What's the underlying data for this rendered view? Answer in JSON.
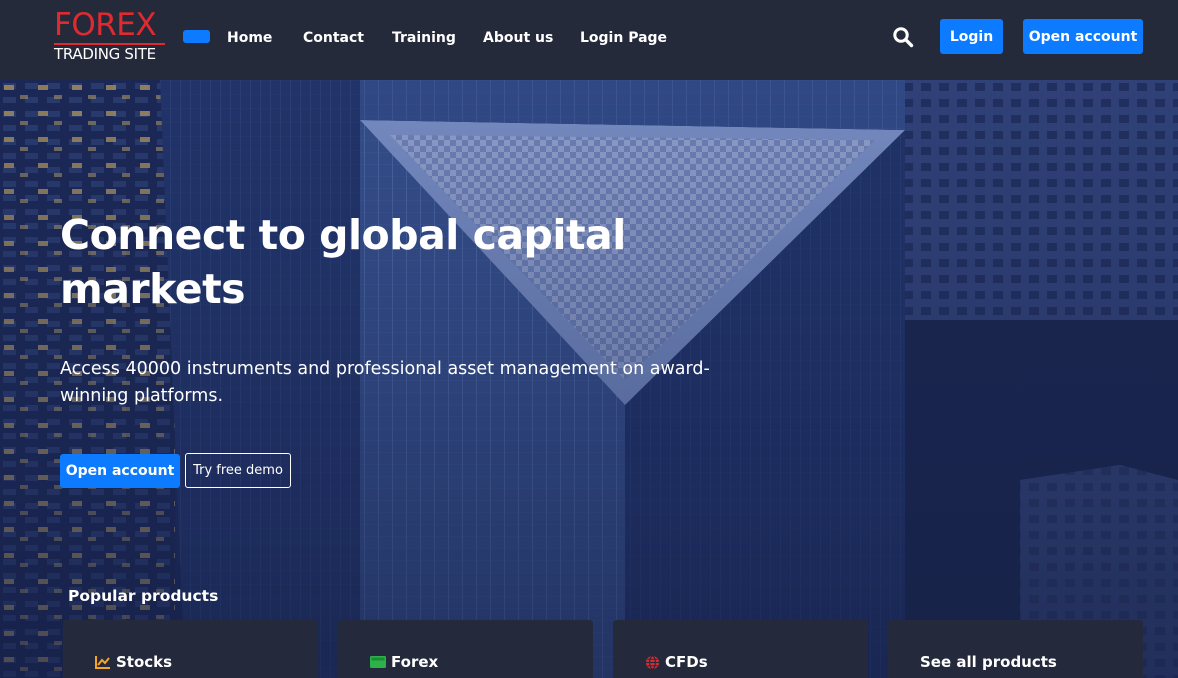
{
  "brand": {
    "logo_top": "FOREX",
    "logo_bottom": "TRADING SITE",
    "accent_color": "#e02a30"
  },
  "nav": {
    "items": [
      {
        "label": "Home"
      },
      {
        "label": "Contact"
      },
      {
        "label": "Training"
      },
      {
        "label": "About us"
      },
      {
        "label": "Login Page"
      }
    ],
    "toggler_icon": "menu-toggle-icon",
    "search_icon": "search-icon",
    "login_label": "Login",
    "open_account_label": "Open account",
    "button_color": "#0d7bff"
  },
  "hero": {
    "title": "Connect to global capital markets",
    "subtitle": "Access 40000 instruments and professional asset management on award-winning platforms.",
    "primary_label": "Open account",
    "secondary_label": "Try free demo"
  },
  "products": {
    "heading": "Popular products",
    "cards": [
      {
        "label": "Stocks",
        "icon": "chart-line-icon",
        "icon_color": "#f5a623"
      },
      {
        "label": "Forex",
        "icon": "money-bill-icon",
        "icon_color": "#2bb34a"
      },
      {
        "label": "CFDs",
        "icon": "globe-icon",
        "icon_color": "#e02a30"
      },
      {
        "label": "See all products",
        "icon": "",
        "icon_color": ""
      }
    ]
  }
}
